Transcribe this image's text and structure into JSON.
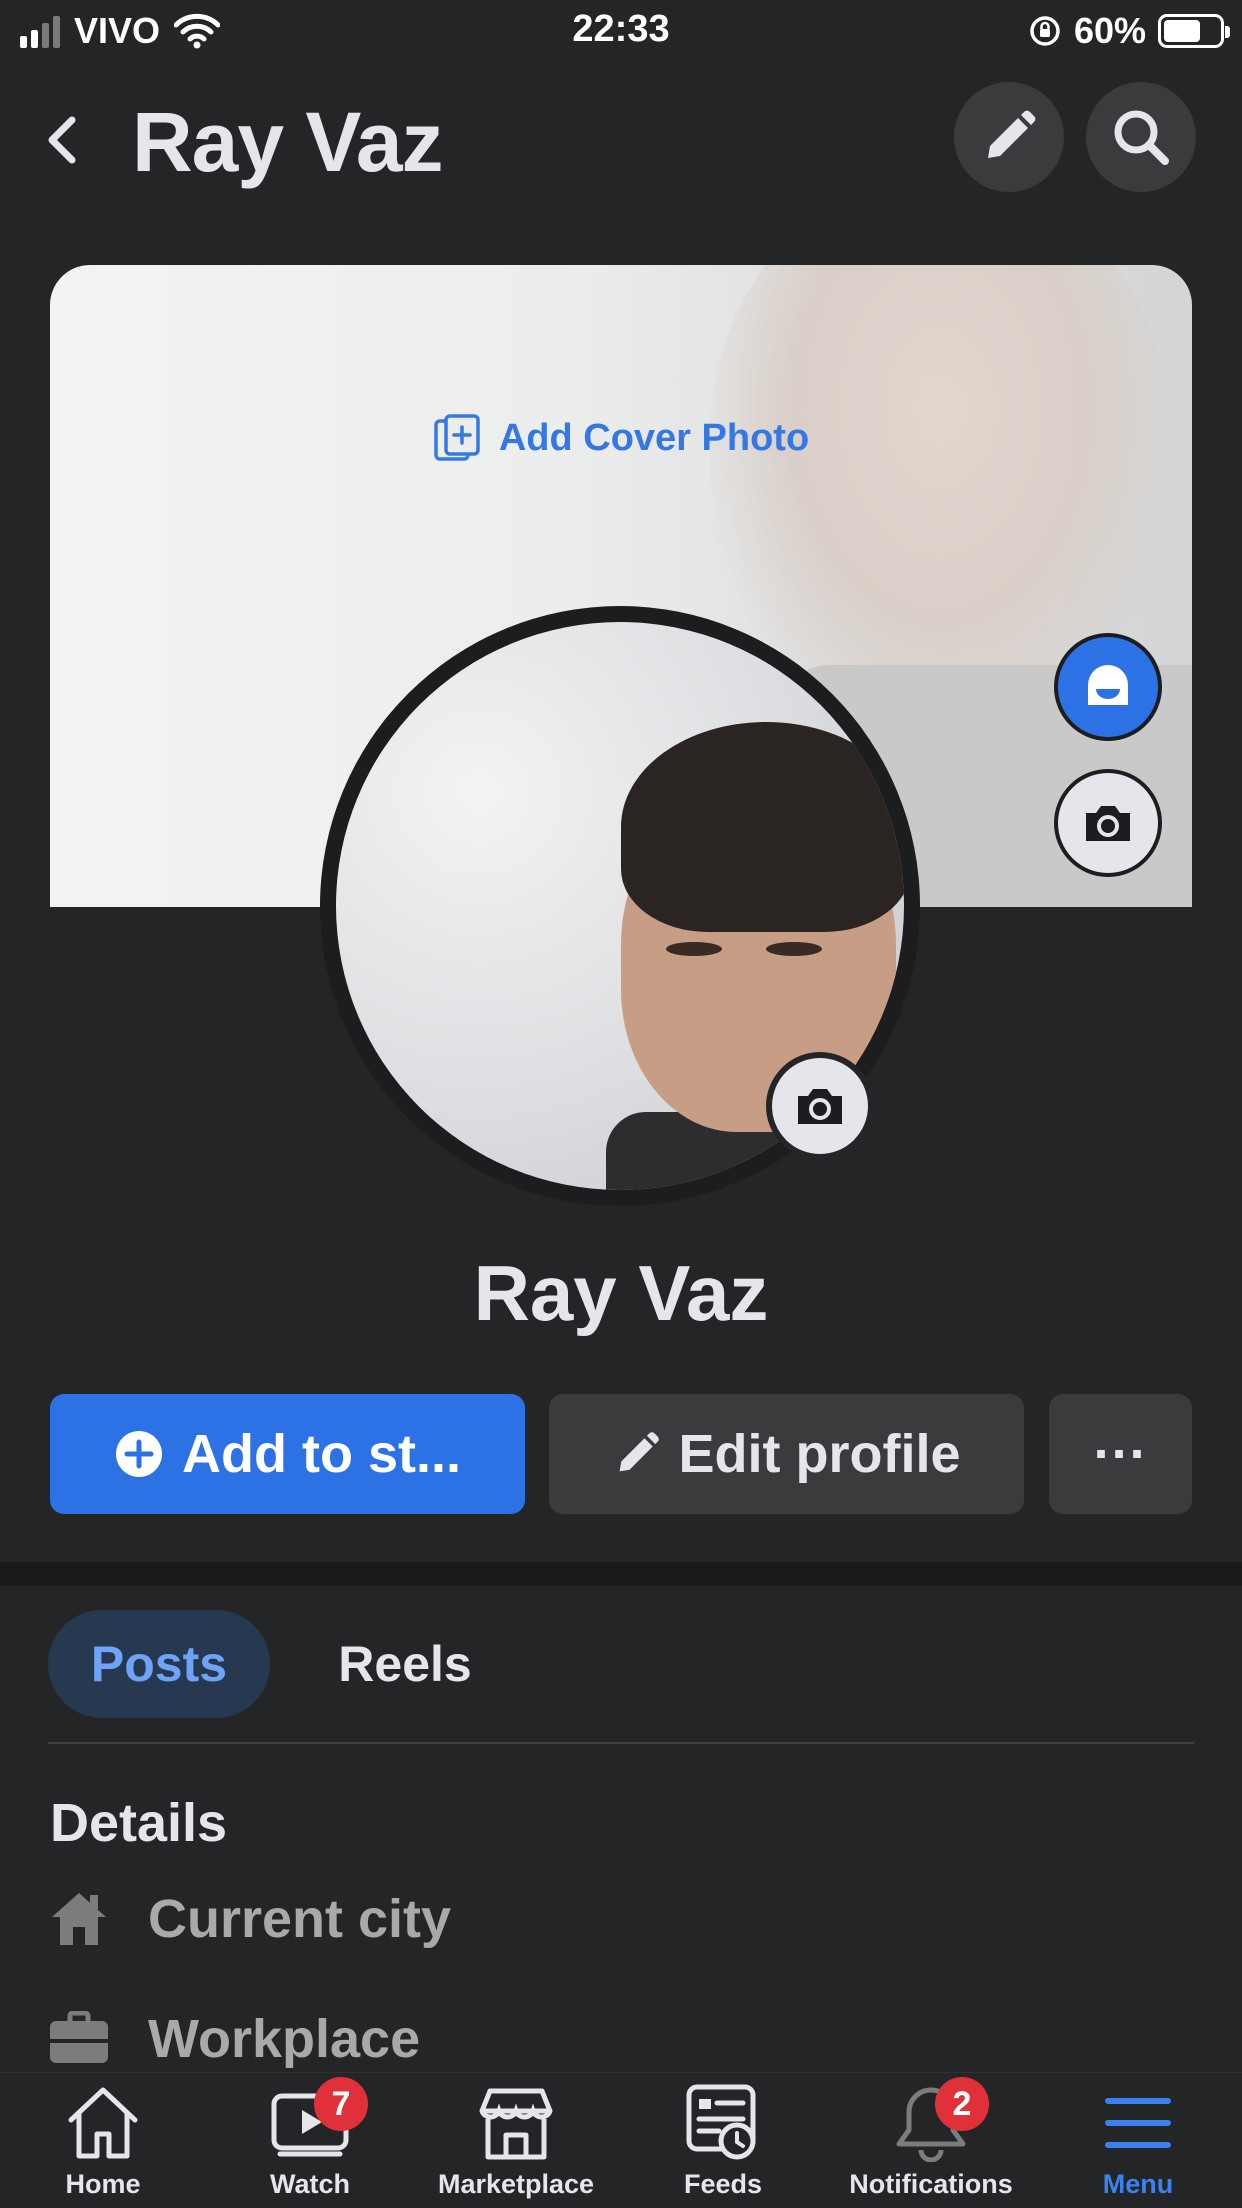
{
  "status_bar": {
    "carrier": "VIVO",
    "time": "22:33",
    "battery": "60%"
  },
  "header": {
    "title": "Ray Vaz"
  },
  "cover": {
    "add_cover_label": "Add Cover Photo"
  },
  "profile": {
    "name": "Ray Vaz"
  },
  "actions": {
    "add_story": "Add to st...",
    "edit_profile": "Edit profile",
    "more": "···"
  },
  "tabs": [
    {
      "label": "Posts",
      "active": true
    },
    {
      "label": "Reels",
      "active": false
    }
  ],
  "details": {
    "title": "Details",
    "items": [
      {
        "label": "Current city",
        "icon": "house-icon"
      },
      {
        "label": "Workplace",
        "icon": "briefcase-icon"
      }
    ]
  },
  "bottom_nav": [
    {
      "label": "Home",
      "icon": "home-icon"
    },
    {
      "label": "Watch",
      "icon": "watch-icon",
      "badge": "7"
    },
    {
      "label": "Marketplace",
      "icon": "marketplace-icon"
    },
    {
      "label": "Feeds",
      "icon": "feeds-icon"
    },
    {
      "label": "Notifications",
      "icon": "bell-icon",
      "badge": "2"
    },
    {
      "label": "Menu",
      "icon": "menu-icon",
      "active": true
    }
  ],
  "colors": {
    "accent": "#2d72e5",
    "background": "#242526",
    "badge": "#e0313a"
  }
}
